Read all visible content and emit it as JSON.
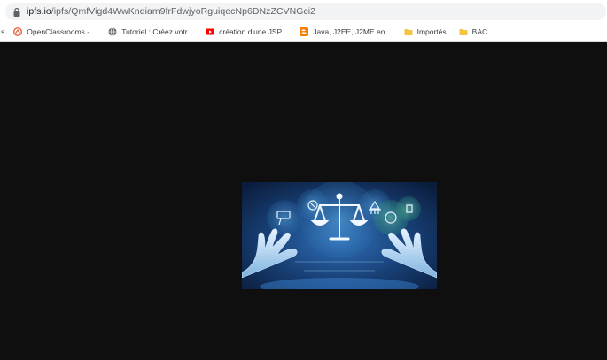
{
  "address_bar": {
    "host": "ipfs.io",
    "path": "/ipfs/QmfVigd4WwKndiam9frFdwjyoRguiqecNp6DNzZCVNGci2"
  },
  "bookmarks": [
    {
      "label": "s",
      "icon": "none"
    },
    {
      "label": "OpenClassrooms -...",
      "icon": "openclassrooms-icon"
    },
    {
      "label": "Tutoriel : Créez votr...",
      "icon": "globe-icon"
    },
    {
      "label": "création d'une JSP...",
      "icon": "youtube-icon"
    },
    {
      "label": "Java, J2EE, J2ME en...",
      "icon": "blogger-icon"
    },
    {
      "label": "Importés",
      "icon": "folder-icon"
    },
    {
      "label": "BAC",
      "icon": "folder-icon"
    }
  ],
  "viewport": {
    "background": "#0f0f0f",
    "image": {
      "description_icon": "justice-scale-robot-hands-image"
    }
  }
}
